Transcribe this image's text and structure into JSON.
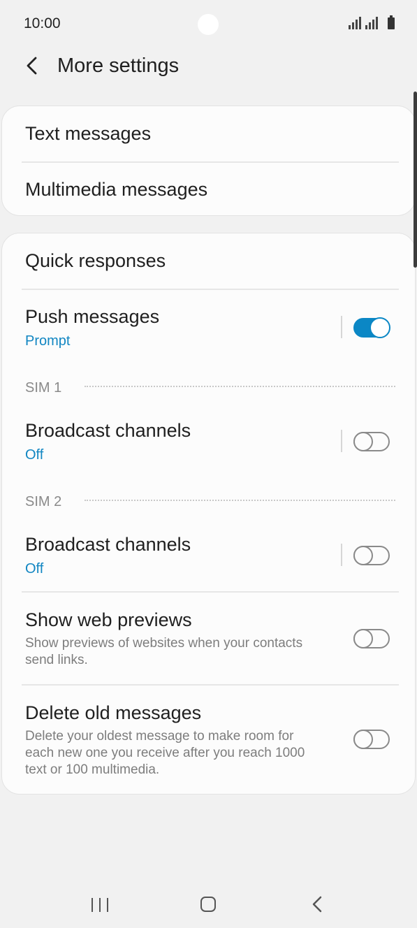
{
  "status": {
    "time": "10:00"
  },
  "header": {
    "title": "More settings"
  },
  "card1": {
    "text_messages": "Text messages",
    "multimedia_messages": "Multimedia messages"
  },
  "card2": {
    "quick_responses": "Quick responses",
    "push_messages": {
      "title": "Push messages",
      "sub": "Prompt",
      "toggle": "on"
    },
    "sim1_header": "SIM 1",
    "broadcast1": {
      "title": "Broadcast channels",
      "sub": "Off",
      "toggle": "off"
    },
    "sim2_header": "SIM 2",
    "broadcast2": {
      "title": "Broadcast channels",
      "sub": "Off",
      "toggle": "off"
    },
    "web_previews": {
      "title": "Show web previews",
      "desc": "Show previews of websites when your contacts send links.",
      "toggle": "off"
    },
    "delete_old": {
      "title": "Delete old messages",
      "desc": "Delete your oldest message to make room for each new one you receive after you reach 1000 text or 100 multimedia.",
      "toggle": "off"
    }
  },
  "icons": {
    "back": "chevron-left-icon",
    "signal": "signal-icon",
    "battery": "battery-icon",
    "recents": "recents-icon",
    "home": "home-icon",
    "nav_back": "nav-back-icon"
  },
  "colors": {
    "accent": "#0b87c5",
    "background": "#f1f1f1",
    "card": "#fcfcfc"
  }
}
